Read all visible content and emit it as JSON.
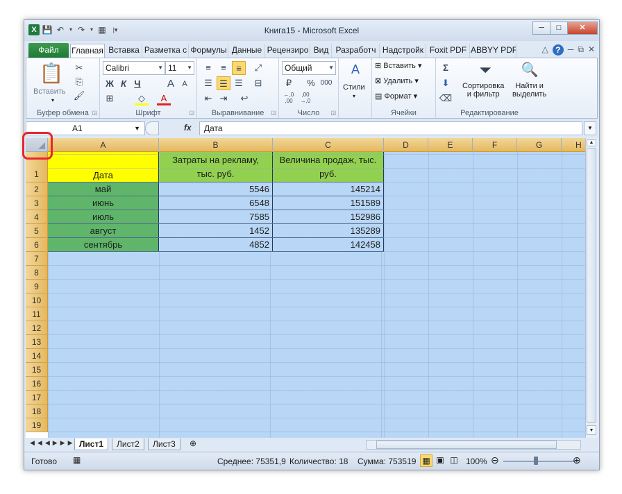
{
  "window": {
    "title": "Книга15 - Microsoft Excel"
  },
  "tabs": [
    "Файл",
    "Главная",
    "Вставка",
    "Разметка с",
    "Формулы",
    "Данные",
    "Рецензиро",
    "Вид",
    "Разработч",
    "Надстройк",
    "Foxit PDF",
    "ABBYY PDF"
  ],
  "ribbon": {
    "clipboard": {
      "paste": "Вставить",
      "label": "Буфер обмена"
    },
    "font": {
      "name": "Calibri",
      "size": "11",
      "bold": "Ж",
      "italic": "К",
      "underline": "Ч",
      "grow": "A",
      "shrink": "A",
      "label": "Шрифт"
    },
    "alignment": {
      "label": "Выравнивание"
    },
    "number": {
      "format": "Общий",
      "percent": "%",
      "thousands": "000",
      "inc": "←,0\n,00",
      "dec": ",00\n→,0",
      "label": "Число"
    },
    "styles": {
      "label": "Стили"
    },
    "cells": {
      "insert": "Вставить",
      "delete": "Удалить",
      "format": "Формат",
      "label": "Ячейки"
    },
    "editing": {
      "sort": "Сортировка\nи фильтр",
      "find": "Найти и\nвыделить",
      "label": "Редактирование"
    }
  },
  "formula_bar": {
    "name_box": "A1",
    "fx": "fx",
    "value": "Дата"
  },
  "columns": [
    "A",
    "B",
    "C",
    "D",
    "E",
    "F",
    "G",
    "H"
  ],
  "rows": [
    "1",
    "2",
    "3",
    "4",
    "5",
    "6",
    "7",
    "8",
    "9",
    "10",
    "11",
    "12",
    "13",
    "14",
    "15",
    "16",
    "17",
    "18",
    "19"
  ],
  "table": {
    "header": {
      "a": "Дата",
      "b": "Затраты на рекламу,\nтыс. руб.",
      "c": "Величина продаж, тыс.\nруб."
    },
    "data": [
      {
        "month": "май",
        "cost": "5546",
        "sales": "145214"
      },
      {
        "month": "июнь",
        "cost": "6548",
        "sales": "151589"
      },
      {
        "month": "июль",
        "cost": "7585",
        "sales": "152986"
      },
      {
        "month": "август",
        "cost": "1452",
        "sales": "135289"
      },
      {
        "month": "сентябрь",
        "cost": "4852",
        "sales": "142458"
      }
    ]
  },
  "sheets": [
    "Лист1",
    "Лист2",
    "Лист3"
  ],
  "status": {
    "ready": "Готово",
    "average": "Среднее: 75351,9",
    "count": "Количество: 18",
    "sum": "Сумма: 753519",
    "zoom": "100%"
  },
  "colors": {
    "header_yellow": "#ffff00",
    "header_green": "#92d050",
    "month_green": "#5fb56a",
    "selection": "#b8d6f6",
    "highlight": "#e8262a"
  }
}
